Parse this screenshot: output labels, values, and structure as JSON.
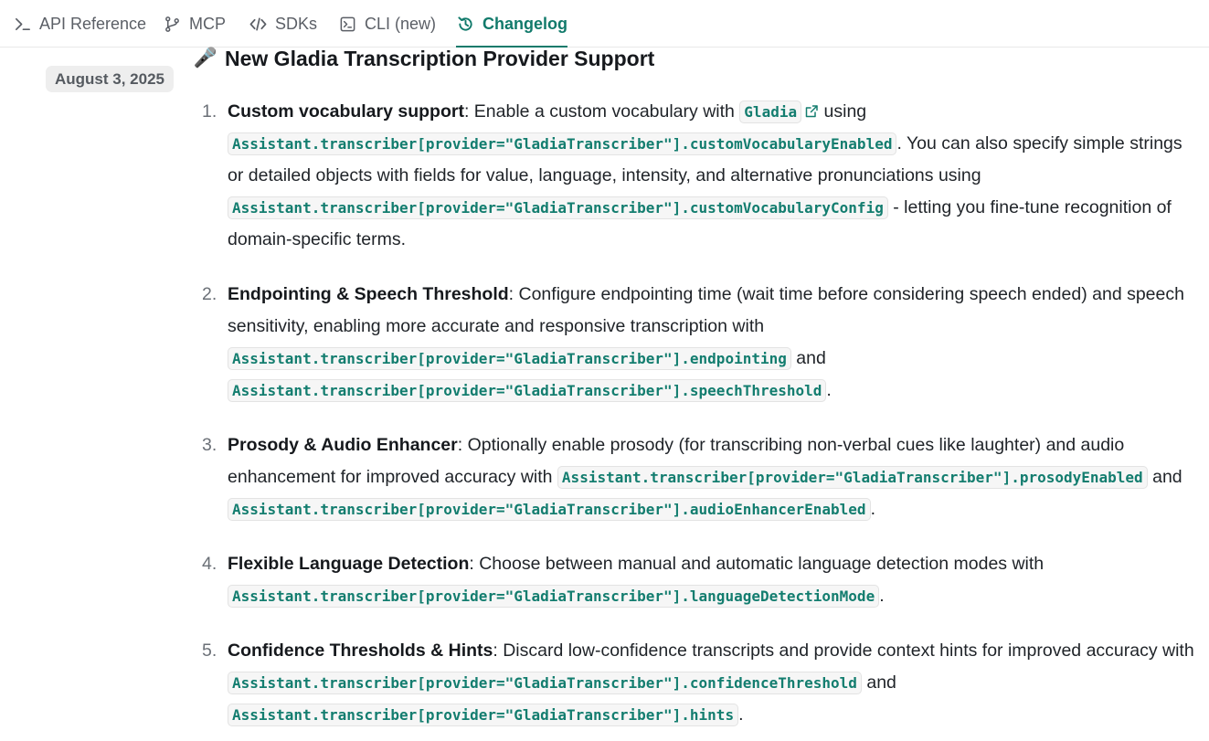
{
  "nav": {
    "tabs": [
      {
        "label": "API Reference",
        "icon": "terminal-prompt-icon"
      },
      {
        "label": "MCP",
        "icon": "git-branch-icon"
      },
      {
        "label": "SDKs",
        "icon": "code-brackets-icon"
      },
      {
        "label": "CLI (new)",
        "icon": "terminal-window-icon"
      },
      {
        "label": "Changelog",
        "icon": "history-icon",
        "active": true
      }
    ]
  },
  "entry": {
    "date": "August 3, 2025",
    "title": "New Gladia Transcription Provider Support",
    "title_emoji": "🎤",
    "items": [
      {
        "number": "1.",
        "heading": "Custom vocabulary support",
        "text_a": ": Enable a custom vocabulary with ",
        "link": "Gladia",
        "text_b": " using ",
        "code_a": "Assistant.transcriber[provider=\"GladiaTranscriber\"].customVocabularyEnabled",
        "text_c": ". You can also specify simple strings or detailed objects with fields for value, language, intensity, and alternative pronunciations using ",
        "code_b": "Assistant.transcriber[provider=\"GladiaTranscriber\"].customVocabularyConfig",
        "text_d": " - letting you fine-tune recognition of domain-specific terms."
      },
      {
        "number": "2.",
        "heading": "Endpointing & Speech Threshold",
        "text_a": ": Configure endpointing time (wait time before considering speech ended) and speech sensitivity, enabling more accurate and responsive transcription with ",
        "code_a": "Assistant.transcriber[provider=\"GladiaTranscriber\"].endpointing",
        "text_b": " and ",
        "code_b": "Assistant.transcriber[provider=\"GladiaTranscriber\"].speechThreshold",
        "text_c": "."
      },
      {
        "number": "3.",
        "heading": "Prosody & Audio Enhancer",
        "text_a": ": Optionally enable prosody (for transcribing non-verbal cues like laughter) and audio enhancement for improved accuracy with ",
        "code_a": "Assistant.transcriber[provider=\"GladiaTranscriber\"].prosodyEnabled",
        "text_b": " and ",
        "code_b": "Assistant.transcriber[provider=\"GladiaTranscriber\"].audioEnhancerEnabled",
        "text_c": "."
      },
      {
        "number": "4.",
        "heading": "Flexible Language Detection",
        "text_a": ": Choose between manual and automatic language detection modes with ",
        "code_a": "Assistant.transcriber[provider=\"GladiaTranscriber\"].languageDetectionMode",
        "text_b": "."
      },
      {
        "number": "5.",
        "heading": "Confidence Thresholds & Hints",
        "text_a": ": Discard low-confidence transcripts and provide context hints for improved accuracy with ",
        "code_a": "Assistant.transcriber[provider=\"GladiaTranscriber\"].confidenceThreshold",
        "text_b": " and ",
        "code_b": "Assistant.transcriber[provider=\"GladiaTranscriber\"].hints",
        "text_c": "."
      }
    ]
  },
  "colors": {
    "accent": "#117a6b",
    "code_text": "#137d6f",
    "code_bg": "#f6f6f6",
    "date_pill_bg": "#eeeeee"
  }
}
